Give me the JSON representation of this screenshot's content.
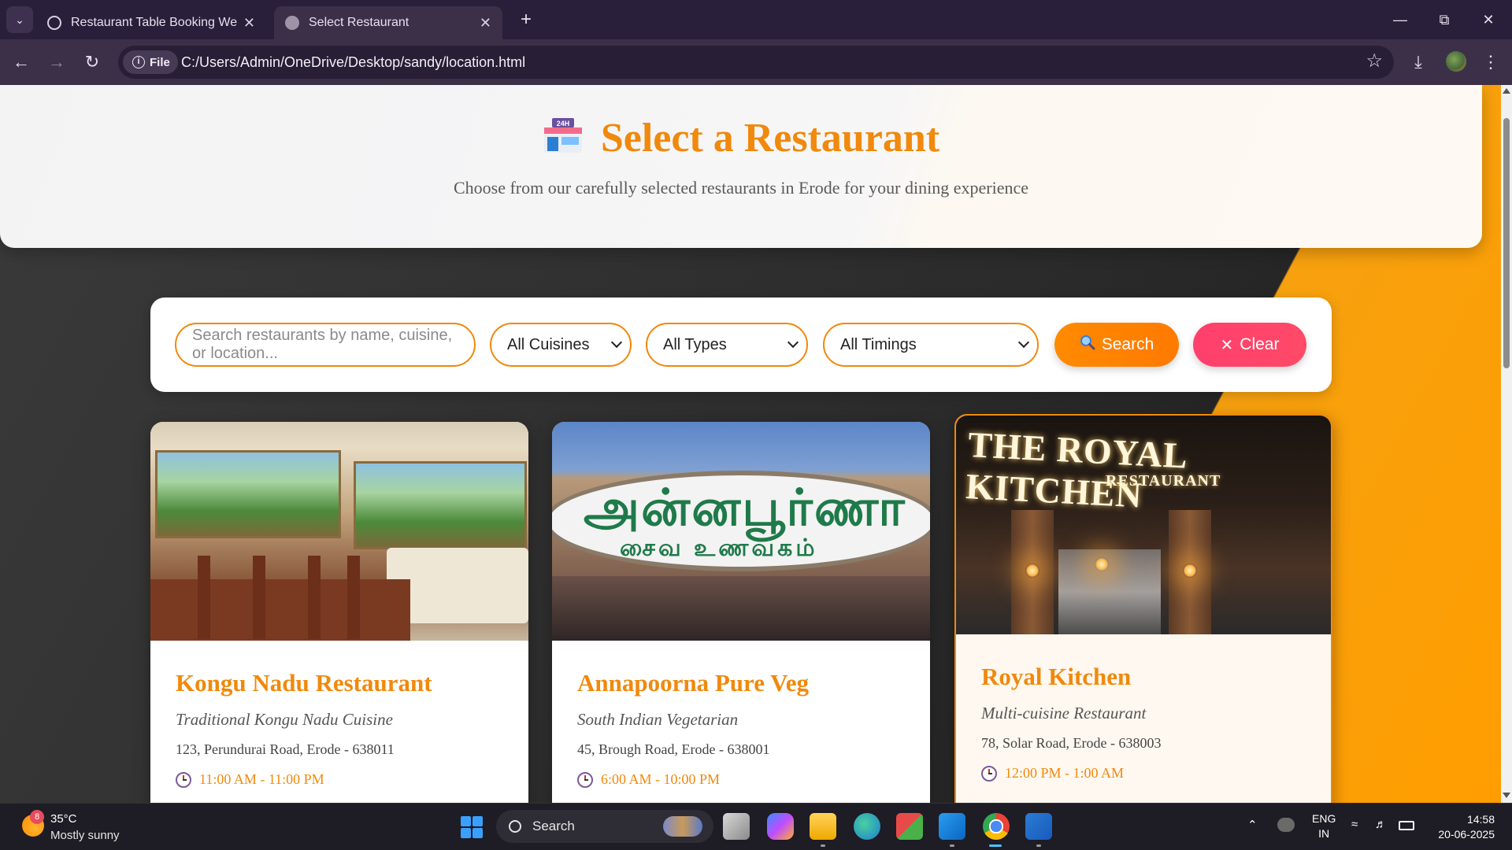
{
  "browser": {
    "tabs": [
      {
        "title": "Restaurant Table Booking Website"
      },
      {
        "title": "Select Restaurant"
      }
    ],
    "new_tab_label": "+",
    "address": {
      "chip_label": "File",
      "url": "C:/Users/Admin/OneDrive/Desktop/sandy/location.html"
    }
  },
  "header": {
    "title": "Select a Restaurant",
    "subtitle": "Choose from our carefully selected restaurants in Erode for your dining experience"
  },
  "search": {
    "placeholder": "Search restaurants by name, cuisine, or location...",
    "cuisine_select": "All Cuisines",
    "type_select": "All Types",
    "timing_select": "All Timings",
    "search_label": "Search",
    "clear_label": "Clear"
  },
  "restaurants": [
    {
      "name": "Kongu Nadu Restaurant",
      "cuisine": "Traditional Kongu Nadu Cuisine",
      "address": "123, Perundurai Road, Erode - 638011",
      "timing": "11:00 AM - 11:00 PM"
    },
    {
      "name": "Annapoorna Pure Veg",
      "cuisine": "South Indian Vegetarian",
      "address": "45, Brough Road, Erode - 638001",
      "timing": "6:00 AM - 10:00 PM",
      "sign_text": "அன்னபூர்ணா",
      "sign_subtext": "சைவ உணவகம்"
    },
    {
      "name": "Royal Kitchen",
      "cuisine": "Multi-cuisine Restaurant",
      "address": "78, Solar Road, Erode - 638003",
      "timing": "12:00 PM - 1:00 AM",
      "sign_text": "THE ROYAL KITCHEN",
      "sign_subtext": "RESTAURANT"
    }
  ],
  "taskbar": {
    "weather": {
      "temp": "35°C",
      "desc": "Mostly sunny",
      "badge": "8"
    },
    "search_label": "Search",
    "language": {
      "line1": "ENG",
      "line2": "IN"
    },
    "time": "14:58",
    "date": "20-06-2025"
  },
  "colors": {
    "accent": "#f0890c",
    "search_button": "#ff8a00",
    "clear_button": "#ff3f6c",
    "browser_frame": "#2a1f3a"
  }
}
